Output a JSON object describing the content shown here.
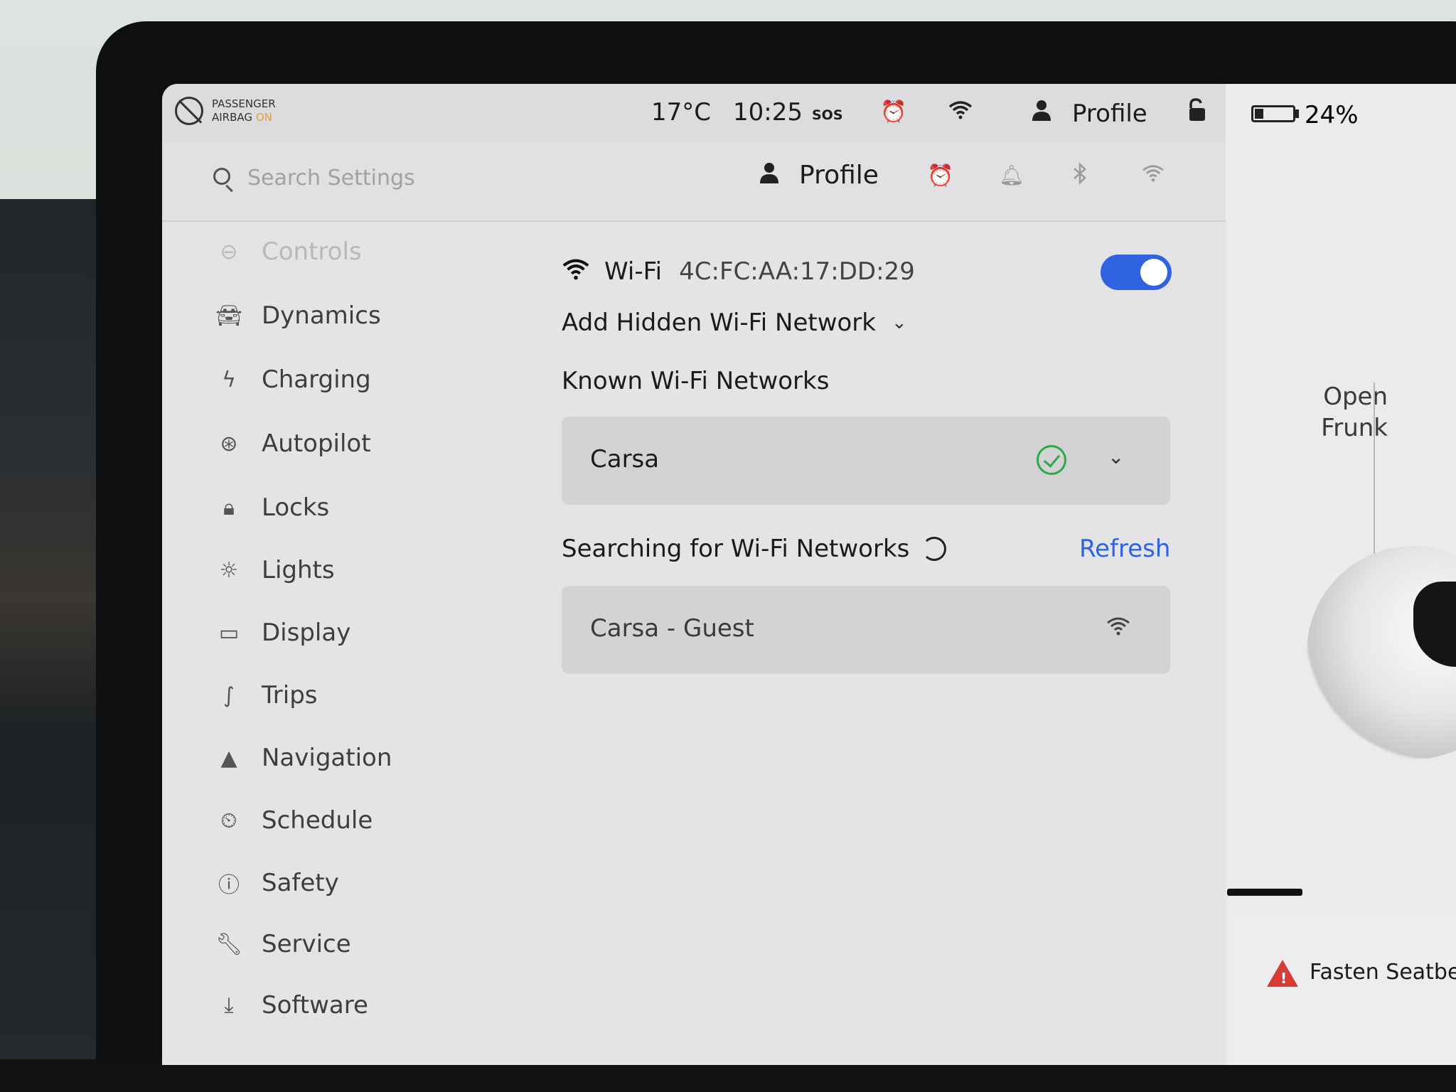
{
  "status_bar": {
    "airbag_line1": "PASSENGER",
    "airbag_line2": "AIRBAG",
    "airbag_state": "ON",
    "temperature": "17°C",
    "time": "10:25",
    "sos": "SOS",
    "profile": "Profile",
    "battery_percent_text": "24%",
    "battery_level": 0.24
  },
  "search": {
    "placeholder": "Search Settings",
    "profile": "Profile"
  },
  "sidebar": {
    "items": [
      {
        "label": "Controls",
        "icon": "toggle-icon"
      },
      {
        "label": "Dynamics",
        "icon": "car-icon"
      },
      {
        "label": "Charging",
        "icon": "bolt-icon"
      },
      {
        "label": "Autopilot",
        "icon": "steering-wheel-icon"
      },
      {
        "label": "Locks",
        "icon": "lock-icon"
      },
      {
        "label": "Lights",
        "icon": "sun-icon"
      },
      {
        "label": "Display",
        "icon": "display-icon"
      },
      {
        "label": "Trips",
        "icon": "trips-icon"
      },
      {
        "label": "Navigation",
        "icon": "navigation-arrow-icon"
      },
      {
        "label": "Schedule",
        "icon": "alarm-clock-icon"
      },
      {
        "label": "Safety",
        "icon": "safety-icon"
      },
      {
        "label": "Service",
        "icon": "wrench-icon"
      },
      {
        "label": "Software",
        "icon": "download-icon"
      }
    ]
  },
  "wifi": {
    "title": "Wi-Fi",
    "mac": "4C:FC:AA:17:DD:29",
    "enabled": true,
    "add_hidden": "Add Hidden Wi-Fi Network",
    "known_title": "Known Wi-Fi Networks",
    "known_networks": [
      {
        "name": "Carsa",
        "connected": true
      }
    ],
    "searching_title": "Searching for Wi-Fi Networks",
    "refresh": "Refresh",
    "available_networks": [
      {
        "name": "Carsa - Guest"
      }
    ]
  },
  "right_panel": {
    "open": "Open",
    "frunk": "Frunk",
    "alert": "Fasten Seatbelt"
  },
  "colors": {
    "accent": "#2f63e0",
    "alarm": "#f0a040",
    "connected": "#2ea84a",
    "warning": "#d83a34"
  }
}
